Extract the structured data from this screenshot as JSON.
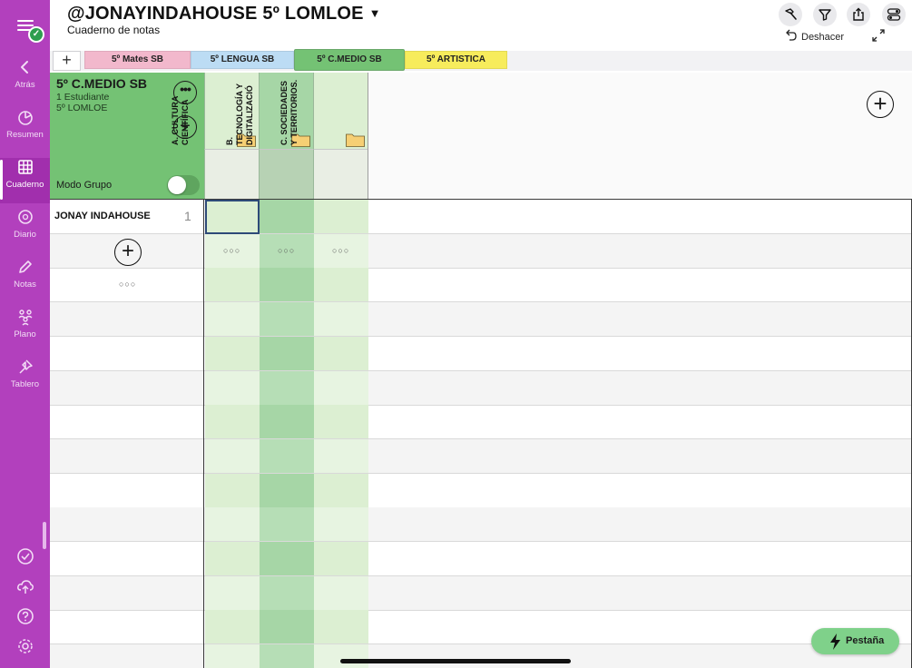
{
  "sidebar": {
    "items": [
      {
        "label": "Atrás",
        "icon": "chevron-left-icon"
      },
      {
        "label": "Resumen",
        "icon": "pie-chart-icon"
      },
      {
        "label": "Cuaderno",
        "icon": "grid-icon"
      },
      {
        "label": "Diario",
        "icon": "chat-bubble-icon"
      },
      {
        "label": "Notas",
        "icon": "pencil-icon"
      },
      {
        "label": "Plano",
        "icon": "people-icon"
      },
      {
        "label": "Tablero",
        "icon": "pin-icon"
      }
    ],
    "active": "Cuaderno",
    "bottom_icons": [
      "check-circle-icon",
      "cloud-upload-icon",
      "help-icon",
      "settings-icon"
    ],
    "accent": "#b240bd"
  },
  "header": {
    "title": "@JONAYINDAHOUSE 5º LOMLOE",
    "title_caret": "▼",
    "subtitle": "Cuaderno de notas",
    "undo_label": "Deshacer",
    "buttons": [
      "hammer-icon",
      "filter-icon",
      "share-icon",
      "toggles-icon"
    ]
  },
  "tabs": [
    {
      "label": "5º Mates SB",
      "color": "#f2b8cc"
    },
    {
      "label": "5º LENGUA SB",
      "color": "#bcdcf4"
    },
    {
      "label": "5º C.MEDIO SB",
      "color": "#74c274",
      "active": true
    },
    {
      "label": "5º ARTISTICA",
      "color": "#f7ec5c"
    }
  ],
  "add_tab_label": "+",
  "group": {
    "name": "5º C.MEDIO SB",
    "students_count_text": "1 Estudiante",
    "course": "5º LOMLOE",
    "mode_label": "Modo Grupo",
    "mode_on": false,
    "more_label": "•••",
    "add_label": "+"
  },
  "columns": [
    {
      "label_line1": "A. CULTURA",
      "label_line2": "CIENTÍFICA",
      "label_line3": "",
      "shade": "light"
    },
    {
      "label_line1": "B.",
      "label_line2": "TECNOLOGÍA Y",
      "label_line3": "DIGITALIZACIÓ",
      "shade": "dark"
    },
    {
      "label_line1": "C. SOCIEDADES",
      "label_line2": "Y TERRITORIOS.",
      "label_line3": "",
      "shade": "light"
    }
  ],
  "add_column_label": "+",
  "students": [
    {
      "name": "JONAY INDAHOUSE",
      "number": "1"
    }
  ],
  "add_student_label": "+",
  "dots_label": "○○○",
  "fab": {
    "label": "Pestaña",
    "icon": "bolt-icon"
  },
  "colors": {
    "col_light": "#dcefd2",
    "col_dark": "#a6d6a6",
    "col_light_alt": "#e7f4e1",
    "col_dark_alt": "#b6deb6",
    "selection_border": "#2e4a78"
  }
}
